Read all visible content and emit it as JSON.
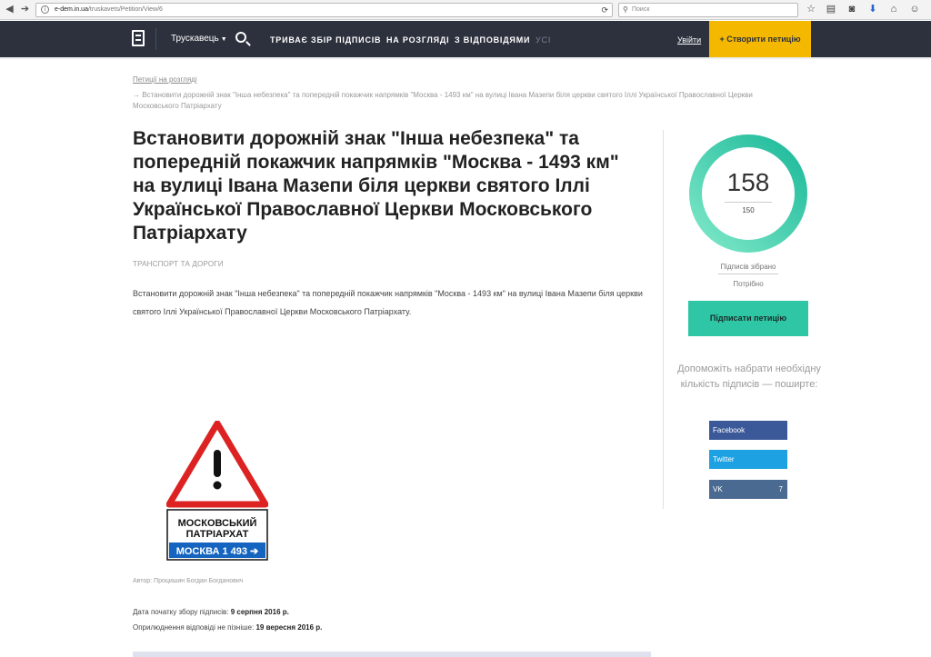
{
  "browser": {
    "url_host": "e-dem.in.ua",
    "url_path": "/truskavets/Petition/View/6",
    "search_placeholder": "Поиск"
  },
  "header": {
    "city": "Трускавець",
    "nav": [
      "ТРИВАЄ ЗБІР ПІДПИСІВ",
      "НА РОЗГЛЯДІ",
      "З ВІДПОВІДЯМИ",
      "УСІ"
    ],
    "login": "Увійти",
    "create": "+ Створити петицію"
  },
  "breadcrumb": {
    "parent": "Петиції на розгляді",
    "current": "→ Встановити дорожній знак \"Інша небезпека\" та попередній покажчик напрямків \"Москва - 1493 км\" на вулиці Івана Мазепи біля церкви святого Іллі Української Православної Церкви Московського Патріархату"
  },
  "petition": {
    "title": "Встановити дорожній знак \"Інша небезпека\" та попередній покажчик напрямків \"Москва - 1493 км\" на вулиці Івана Мазепи біля церкви святого Іллі Української Православної Церкви Московського Патріархату",
    "category": "ТРАНСПОРТ ТА ДОРОГИ",
    "description": "Встановити дорожній знак \"Інша небезпека\" та попередній покажчик напрямків \"Москва - 1493 км\" на вулиці Івана Мазепи біля церкви святого Іллі Української Православної Церкви Московського Патріархату.",
    "sign_text_line1": "МОСКОВСЬКИЙ",
    "sign_text_line2": "ПАТРІАРХАТ",
    "sign_text_blue": "МОСКВА 1 493 ➔",
    "author_label": "Автор:",
    "author": "Процишин Богдан Богданович",
    "start_label": "Дата початку збору підписів:",
    "start_date": "9 серпня 2016 р.",
    "answer_label": "Оприлюднення відповіді не пізніше:",
    "answer_date": "19 вересня 2016 р."
  },
  "sidebar": {
    "signatures": "158",
    "needed": "150",
    "progress_fraction": 1.0,
    "collected_label": "Підписів зібрано",
    "needed_label": "Потрібно",
    "sign_button": "Підписати петицію",
    "help_text": "Допоможіть набрати необхідну кількість підписів — поширте:",
    "share": {
      "facebook": "Facebook",
      "twitter": "Twitter",
      "vk": "VK",
      "vk_count": "7"
    }
  },
  "colors": {
    "header_bg": "#2c313d",
    "create_button": "#f5b800",
    "accent_green": "#2ec6a4",
    "facebook": "#3b5998",
    "twitter": "#1da1e2",
    "vk": "#4a6a92"
  }
}
